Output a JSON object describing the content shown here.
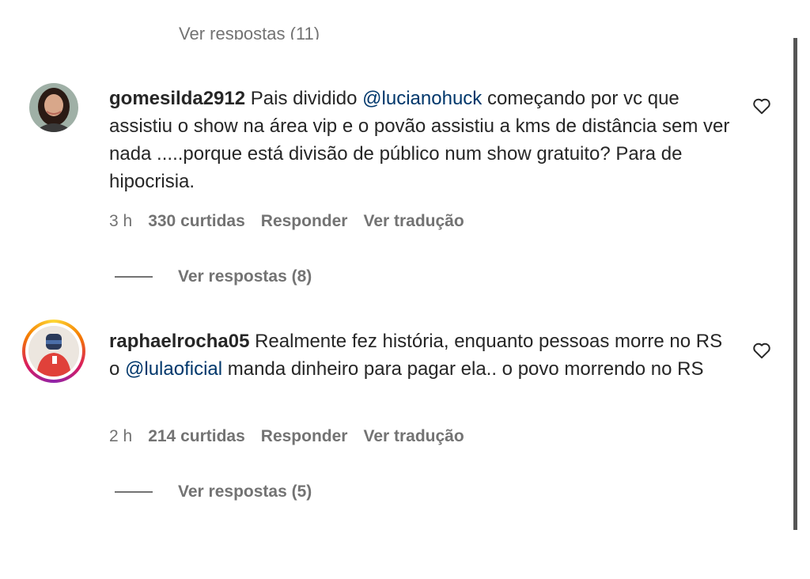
{
  "top_cut_link": "Ver respostas (11)",
  "comments": [
    {
      "username": "gomesilda2912",
      "text_before": " Pais dividido ",
      "mention": "@lucianohuck",
      "text_after": " começando por vc que assistiu o show na área vip e o povão assistiu a kms de distância sem ver nada .....porque está divisão de público num show gratuito? Para de hipocrisia.",
      "time": "3 h",
      "likes": "330 curtidas",
      "reply_label": "Responder",
      "translate_label": "Ver tradução",
      "view_replies": "Ver respostas (8)"
    },
    {
      "username": "raphaelrocha05",
      "text_before": " Realmente fez história, enquanto pessoas morre no RS o ",
      "mention": "@lulaoficial",
      "text_after": " manda dinheiro para pagar ela.. o povo morrendo no RS",
      "time": "2 h",
      "likes": "214 curtidas",
      "reply_label": "Responder",
      "translate_label": "Ver tradução",
      "view_replies": "Ver respostas (5)"
    }
  ],
  "icons": {
    "like": "heart-outline-icon"
  }
}
